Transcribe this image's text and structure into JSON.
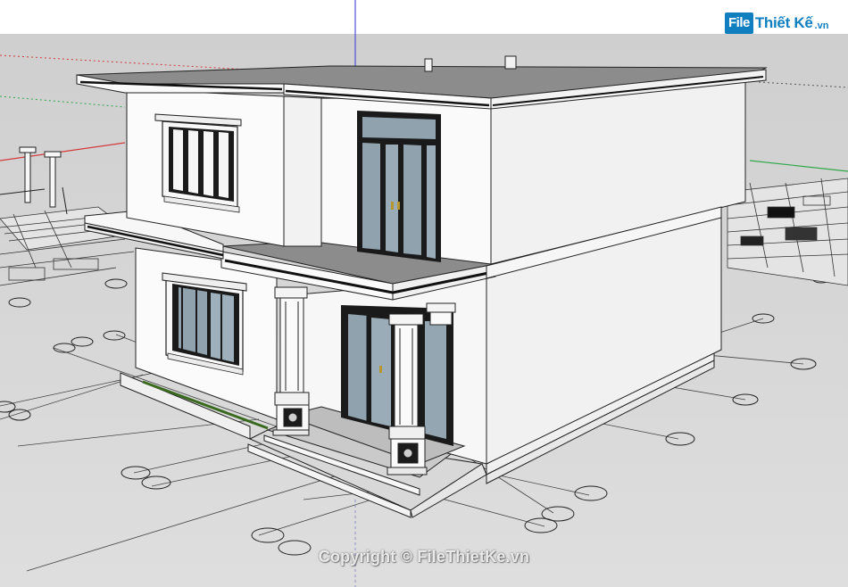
{
  "app": {
    "logo_part1": "File",
    "logo_part2": "Thiết Kế",
    "logo_suffix": ".vn"
  },
  "watermark": "Copyright © FileThietKe.vn",
  "scene": {
    "sky_color": "#ffffff",
    "ground_color": "#d9d9d9",
    "axis_red": "#d23a3a",
    "axis_green": "#2fa84a",
    "axis_blue": "#5050d8",
    "wall_light": "#fbfbfb",
    "wall_shade": "#f1f1f1",
    "glass": "#8fa2ae",
    "frame": "#1e1e1e"
  }
}
